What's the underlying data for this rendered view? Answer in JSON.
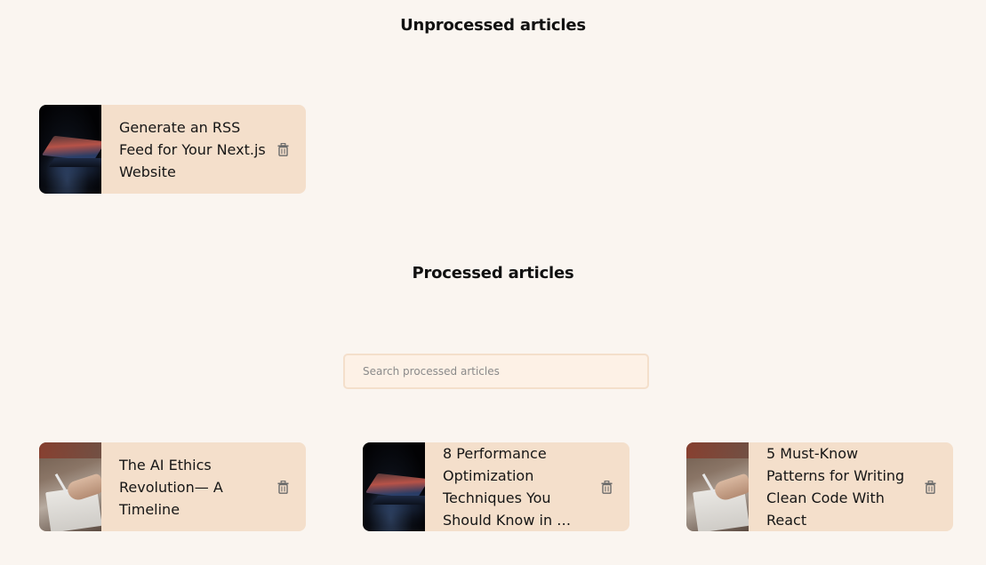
{
  "unprocessed": {
    "title": "Unprocessed articles",
    "articles": [
      {
        "title": "Generate an RSS Feed for Your Next.js Website",
        "image": "laptop-dark"
      }
    ]
  },
  "processed": {
    "title": "Processed articles",
    "search": {
      "placeholder": "Search processed articles",
      "value": ""
    },
    "articles": [
      {
        "title": "The AI Ethics Revolution— A Timeline",
        "image": "hand-writing"
      },
      {
        "title": "8 Performance Optimization Techniques You Should Know in …",
        "image": "laptop-dark"
      },
      {
        "title": "5 Must-Know Patterns for Writing Clean Code With React",
        "image": "hand-writing"
      }
    ]
  },
  "icons": {
    "delete": "trash-icon"
  },
  "colors": {
    "background": "#faf5f0",
    "card": "#f4dfcb",
    "search_border": "#f4dfcb",
    "icon": "#6b6b6b"
  }
}
